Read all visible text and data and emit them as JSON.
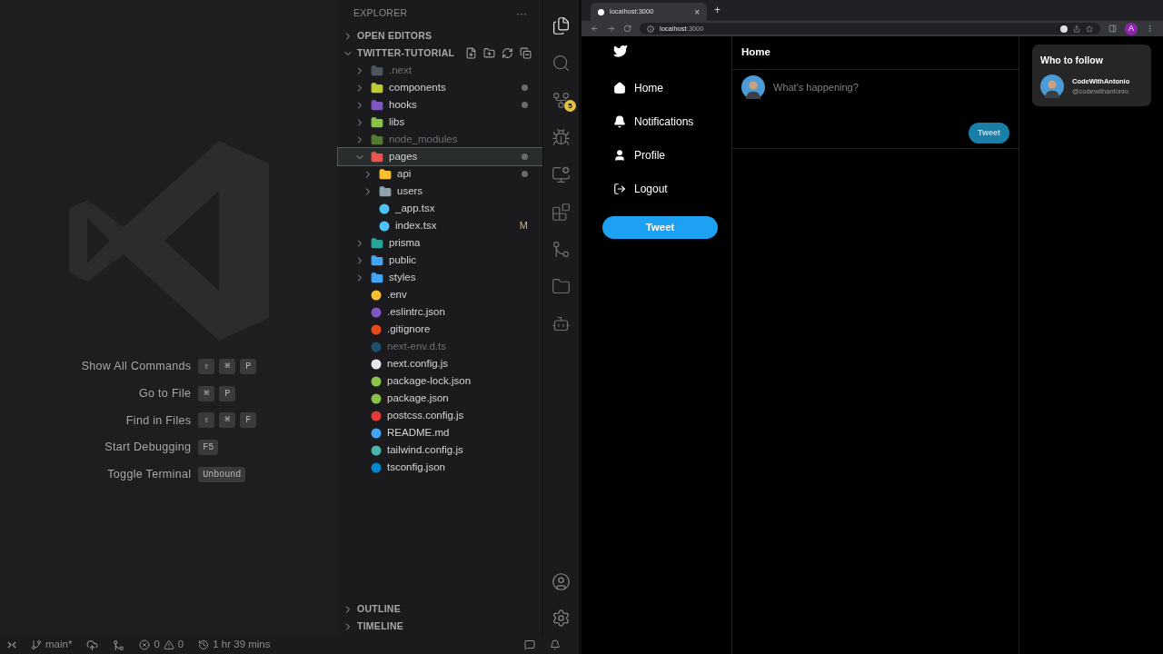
{
  "welcome": {
    "shortcuts": [
      {
        "label": "Show All Commands",
        "keys": [
          "⇧",
          "⌘",
          "P"
        ]
      },
      {
        "label": "Go to File",
        "keys": [
          "⌘",
          "P"
        ]
      },
      {
        "label": "Find in Files",
        "keys": [
          "⇧",
          "⌘",
          "F"
        ]
      },
      {
        "label": "Start Debugging",
        "keys": [
          "F5"
        ]
      },
      {
        "label": "Toggle Terminal",
        "keys": [
          "Unbound"
        ]
      }
    ]
  },
  "explorer": {
    "title": "EXPLORER",
    "more": "···",
    "sections": [
      {
        "label": "OPEN EDITORS",
        "expanded": false
      },
      {
        "label": "TWITTER-TUTORIAL",
        "expanded": true
      }
    ],
    "tree": [
      {
        "name": ".next",
        "kind": "folder",
        "color": "#4b5563",
        "expanded": false,
        "dimmed": true,
        "selected": false,
        "changed": false
      },
      {
        "name": "components",
        "kind": "folder",
        "color": "#c0ca33",
        "expanded": false,
        "dimmed": false,
        "selected": false,
        "changed": true
      },
      {
        "name": "hooks",
        "kind": "folder",
        "color": "#7e57c2",
        "expanded": false,
        "dimmed": false,
        "selected": false,
        "changed": true
      },
      {
        "name": "libs",
        "kind": "folder",
        "color": "#8bc34a",
        "expanded": false,
        "dimmed": false,
        "selected": false,
        "changed": false
      },
      {
        "name": "node_modules",
        "kind": "folder",
        "color": "#557a33",
        "expanded": false,
        "dimmed": true,
        "selected": false,
        "changed": false
      },
      {
        "name": "pages",
        "kind": "folder",
        "color": "#ef5350",
        "expanded": true,
        "dimmed": false,
        "selected": true,
        "changed": true,
        "children": [
          {
            "name": "api",
            "kind": "folder",
            "color": "#fbc02d",
            "expanded": false,
            "dimmed": false,
            "selected": false,
            "changed": true
          },
          {
            "name": "users",
            "kind": "folder",
            "color": "#90a4ae",
            "expanded": false,
            "dimmed": false,
            "selected": false,
            "changed": false
          },
          {
            "name": "_app.tsx",
            "kind": "file",
            "color": "#4fc3f7",
            "dimmed": false,
            "selected": false,
            "changed": false
          },
          {
            "name": "index.tsx",
            "kind": "file",
            "color": "#4fc3f7",
            "dimmed": false,
            "selected": false,
            "changed": false,
            "status": "M"
          }
        ]
      },
      {
        "name": "prisma",
        "kind": "folder",
        "color": "#26a69a",
        "expanded": false,
        "dimmed": false,
        "selected": false,
        "changed": false
      },
      {
        "name": "public",
        "kind": "folder",
        "color": "#42a5f5",
        "expanded": false,
        "dimmed": false,
        "selected": false,
        "changed": false
      },
      {
        "name": "styles",
        "kind": "folder",
        "color": "#42a5f5",
        "expanded": false,
        "dimmed": false,
        "selected": false,
        "changed": false
      },
      {
        "name": ".env",
        "kind": "file",
        "color": "#fbc02d",
        "dimmed": false,
        "selected": false,
        "changed": false
      },
      {
        "name": ".eslintrc.json",
        "kind": "file",
        "color": "#7e57c2",
        "dimmed": false,
        "selected": false,
        "changed": false
      },
      {
        "name": ".gitignore",
        "kind": "file",
        "color": "#e64a19",
        "dimmed": false,
        "selected": false,
        "changed": false
      },
      {
        "name": "next-env.d.ts",
        "kind": "file",
        "color": "#1d4f6e",
        "dimmed": true,
        "selected": false,
        "changed": false
      },
      {
        "name": "next.config.js",
        "kind": "file",
        "color": "#e5e7eb",
        "dimmed": false,
        "selected": false,
        "changed": false
      },
      {
        "name": "package-lock.json",
        "kind": "file",
        "color": "#8bc34a",
        "dimmed": false,
        "selected": false,
        "changed": false
      },
      {
        "name": "package.json",
        "kind": "file",
        "color": "#8bc34a",
        "dimmed": false,
        "selected": false,
        "changed": false
      },
      {
        "name": "postcss.config.js",
        "kind": "file",
        "color": "#e53935",
        "dimmed": false,
        "selected": false,
        "changed": false
      },
      {
        "name": "README.md",
        "kind": "file",
        "color": "#42a5f5",
        "dimmed": false,
        "selected": false,
        "changed": false
      },
      {
        "name": "tailwind.config.js",
        "kind": "file",
        "color": "#4db6ac",
        "dimmed": false,
        "selected": false,
        "changed": false
      },
      {
        "name": "tsconfig.json",
        "kind": "file",
        "color": "#0288d1",
        "dimmed": false,
        "selected": false,
        "changed": false
      }
    ],
    "bottom_sections": [
      {
        "label": "OUTLINE",
        "expanded": false
      },
      {
        "label": "TIMELINE",
        "expanded": false
      }
    ]
  },
  "activity_bar": {
    "items": [
      {
        "kind": "files",
        "selected": true
      },
      {
        "kind": "search",
        "selected": false
      },
      {
        "kind": "source-control",
        "selected": false,
        "badge": "5"
      },
      {
        "kind": "debug",
        "selected": false
      },
      {
        "kind": "remote",
        "selected": false
      },
      {
        "kind": "extensions",
        "selected": false
      },
      {
        "kind": "git-graph",
        "selected": false
      },
      {
        "kind": "folder",
        "selected": false
      },
      {
        "kind": "bot",
        "selected": false
      }
    ],
    "bottom": [
      {
        "kind": "account"
      },
      {
        "kind": "settings"
      }
    ]
  },
  "status_bar": {
    "branch": "main*",
    "errors": "0",
    "warnings": "0",
    "time": "1 hr 39 mins"
  },
  "browser": {
    "tab": {
      "title": "localhost:3000",
      "close": "×"
    },
    "new_tab": "+",
    "address": {
      "host": "localhost",
      "rest": ":3000"
    },
    "profile": "A"
  },
  "app": {
    "nav": [
      {
        "kind": "home",
        "label": "Home"
      },
      {
        "kind": "bell",
        "label": "Notifications"
      },
      {
        "kind": "user",
        "label": "Profile"
      },
      {
        "kind": "logout",
        "label": "Logout"
      }
    ],
    "tweet_button": "Tweet",
    "header": "Home",
    "composer": {
      "placeholder": "What's happening?",
      "button": "Tweet"
    },
    "follow": {
      "title": "Who to follow",
      "users": [
        {
          "name": "CodeWithAntonio",
          "handle": "@codewithantonio"
        }
      ]
    }
  }
}
